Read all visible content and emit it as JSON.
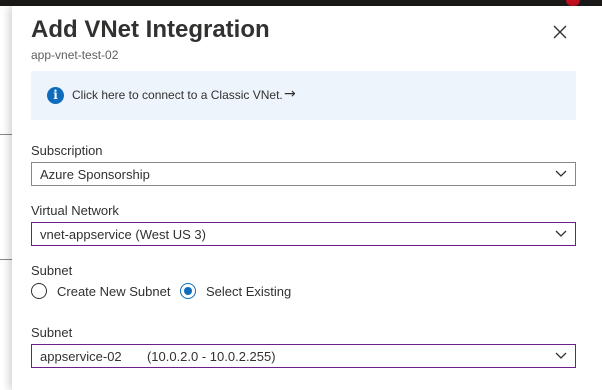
{
  "panel": {
    "title": "Add VNet Integration",
    "subtitle": "app-vnet-test-02",
    "close_icon": "close-icon"
  },
  "info_banner": {
    "icon": "info-icon",
    "icon_glyph": "i",
    "link_text": "Click here to connect to a Classic VNet.",
    "arrow": "→"
  },
  "fields": {
    "subscription": {
      "label": "Subscription",
      "value": "Azure Sponsorship"
    },
    "virtual_network": {
      "label": "Virtual Network",
      "value": "vnet-appservice (West US 3)"
    },
    "subnet_mode": {
      "label": "Subnet",
      "options": [
        {
          "label": "Create New Subnet",
          "selected": false
        },
        {
          "label": "Select Existing",
          "selected": true
        }
      ]
    },
    "subnet": {
      "label": "Subnet",
      "value": "appservice-02       (10.0.2.0 - 10.0.2.255)"
    }
  },
  "colors": {
    "accent": "#0f6cbd",
    "focus_border": "#6b1e8a",
    "info_background": "#eef4fb"
  }
}
